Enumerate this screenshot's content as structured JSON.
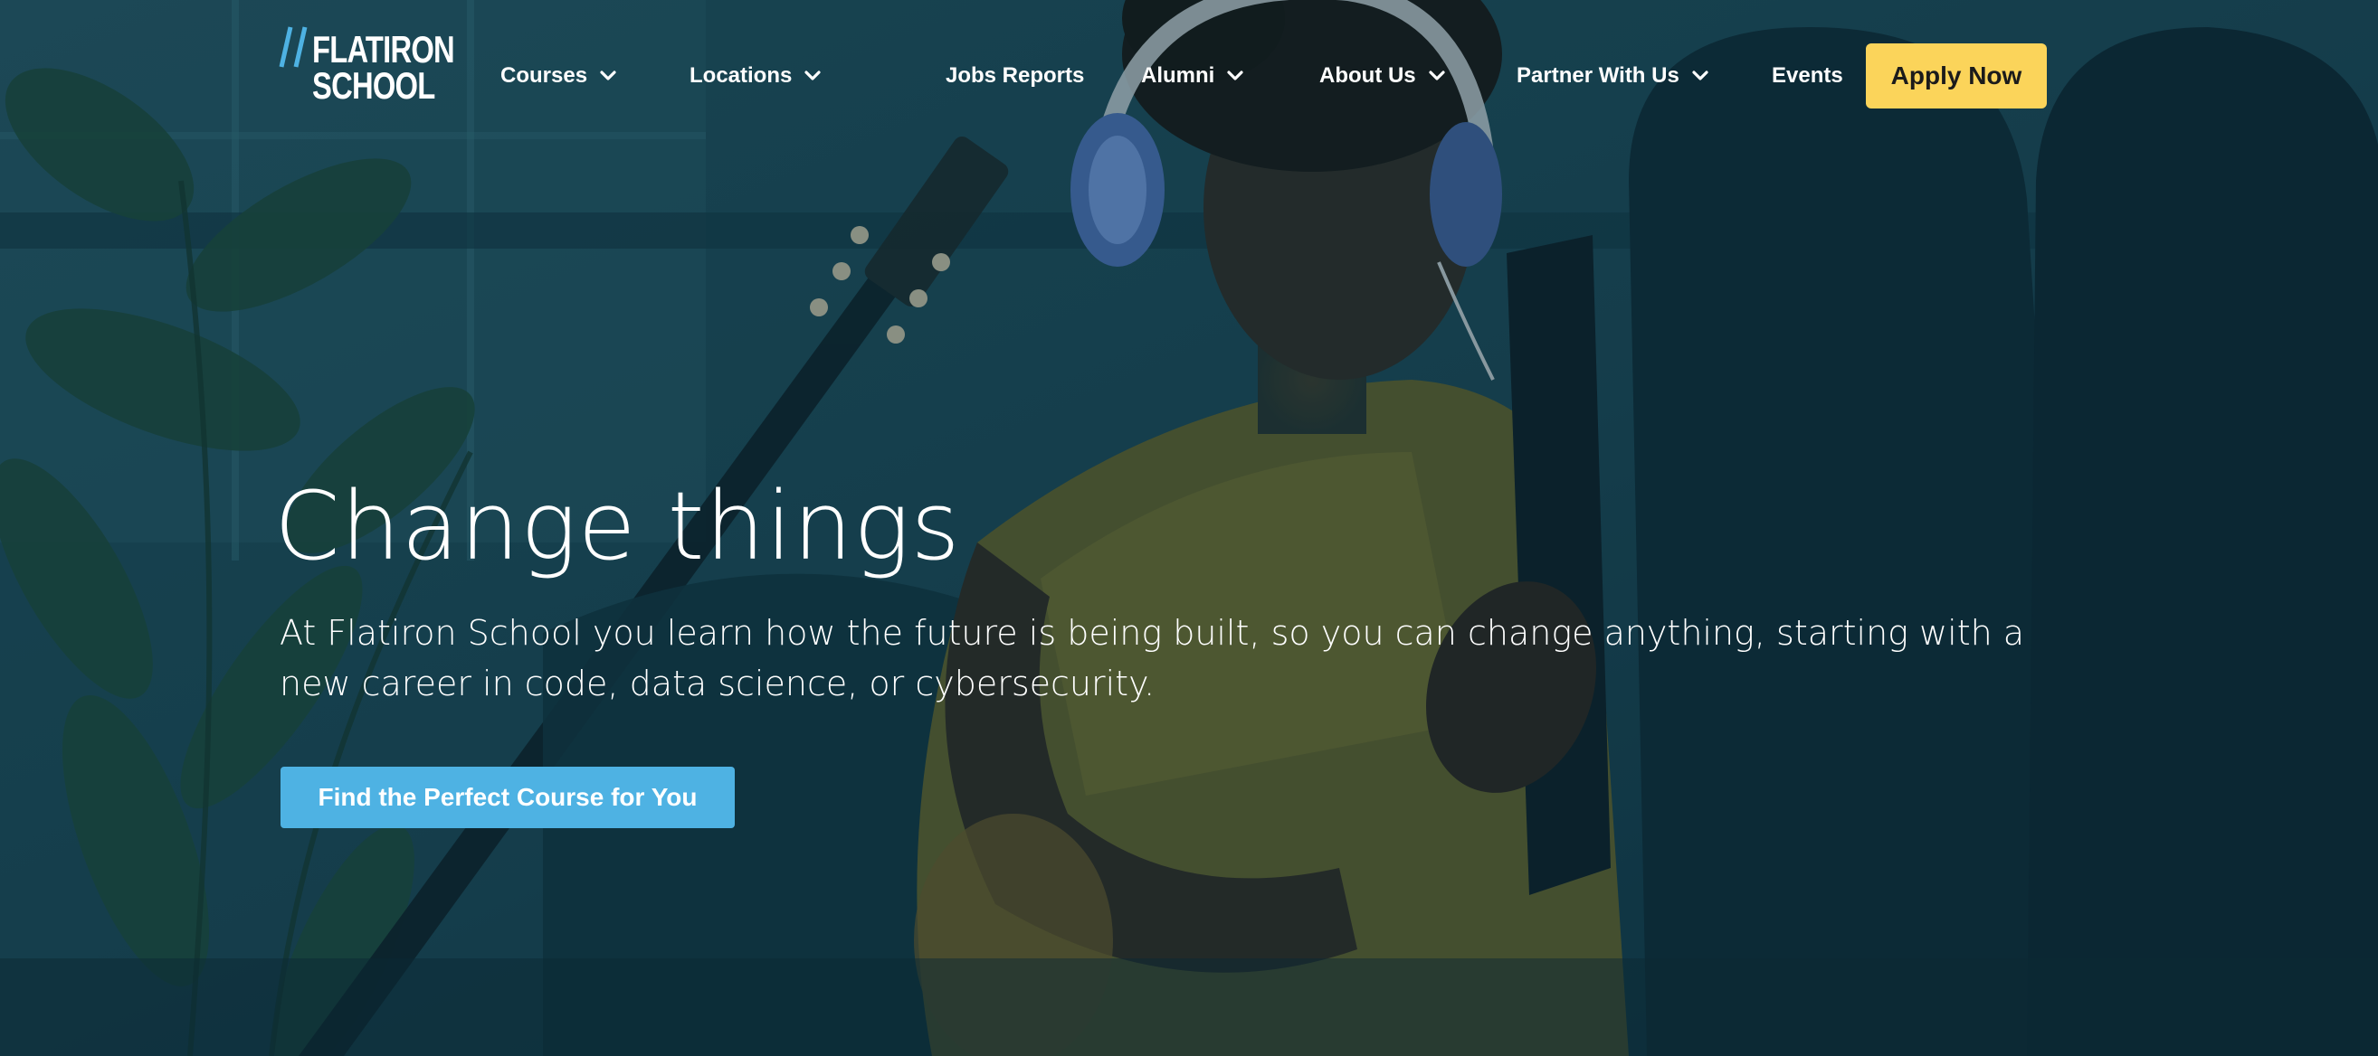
{
  "brand": {
    "logo_line1": "FLATIRON",
    "logo_line2": "SCHOOL",
    "accent_blue": "#4eb2e3",
    "accent_yellow": "#fbd45a"
  },
  "nav": {
    "courses": "Courses",
    "locations": "Locations",
    "jobs_reports": "Jobs Reports",
    "alumni": "Alumni",
    "about_us": "About Us",
    "partner_with_us": "Partner With Us",
    "events": "Events",
    "apply_now": "Apply Now"
  },
  "hero": {
    "headline": "Change things",
    "subtext": "At Flatiron School you learn how the future is being built, so you can change anything, starting with a new career in code, data science, or cybersecurity.",
    "cta_label": "Find the Perfect Course for You",
    "background": "photo of a woman with headphones sitting on a couch with a guitar and a tablet, dark teal overlay"
  },
  "icons": {
    "dropdown": "chevron-down-icon",
    "logo_mark": "double-slash-icon"
  }
}
